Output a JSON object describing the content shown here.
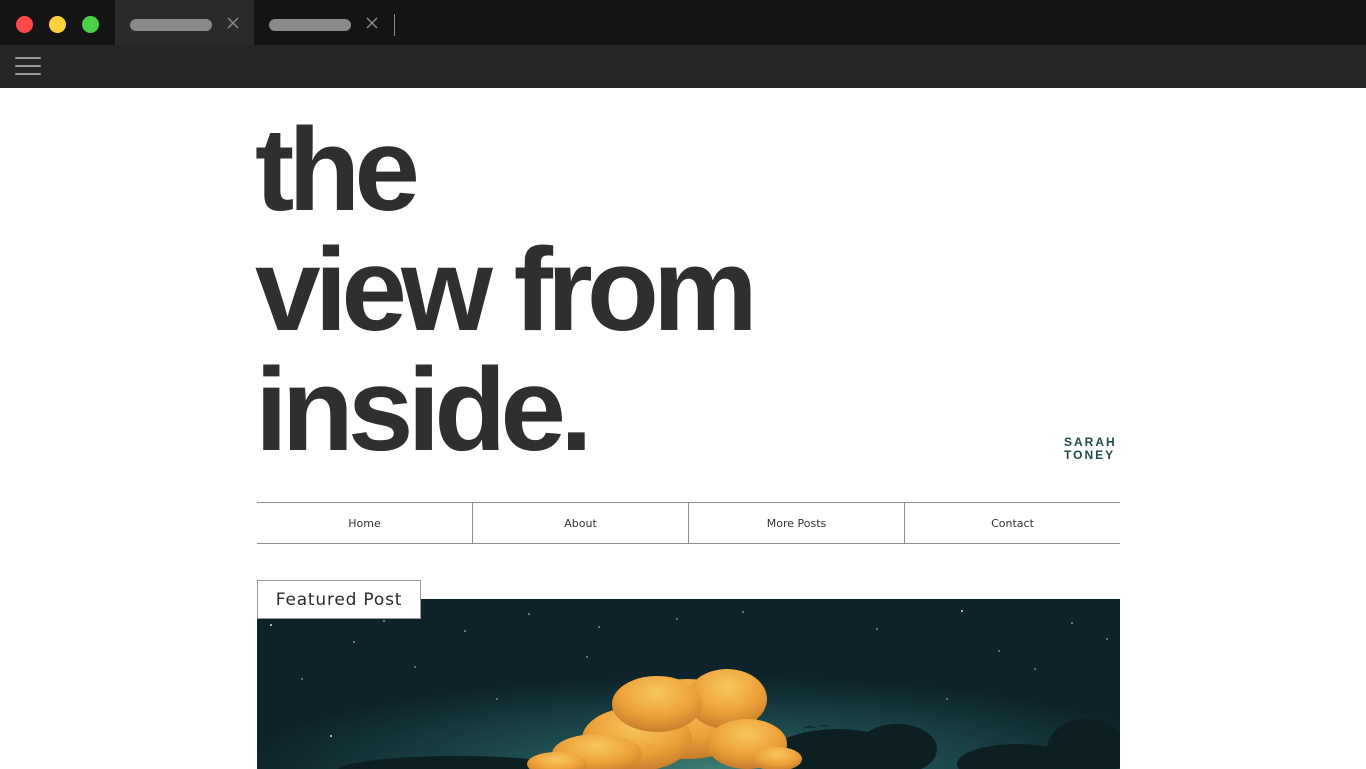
{
  "browser": {
    "window_controls": [
      "close",
      "minimize",
      "maximize"
    ],
    "tabs": [
      {
        "state": "active"
      },
      {
        "state": "inactive"
      }
    ],
    "colors": {
      "close": "#fc4a4a",
      "minimize": "#fdd23a",
      "maximize": "#48d048"
    }
  },
  "hero": {
    "line1": "the",
    "line2": "view from",
    "line3": "inside."
  },
  "logo": {
    "line1": "SARAH",
    "line2": "TONEY"
  },
  "nav": {
    "items": [
      {
        "label": "Home"
      },
      {
        "label": "About"
      },
      {
        "label": "More Posts"
      },
      {
        "label": "Contact"
      }
    ]
  },
  "featured": {
    "label": "Featured Post",
    "image": "night-sky-clouds-image"
  },
  "colors": {
    "hero_text": "#2f2f2f",
    "logo": "#1f4a4a",
    "sky": "#0f2a30",
    "cloud": "#f2a93a"
  }
}
